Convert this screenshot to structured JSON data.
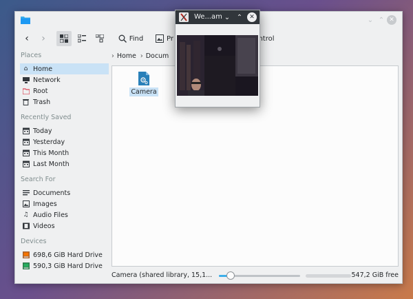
{
  "toolbar": {
    "find_label": "Find",
    "preview_label": "Pr",
    "control_label": "ntrol"
  },
  "sidebar": {
    "places_title": "Places",
    "places": [
      {
        "label": "Home",
        "icon": "home-icon"
      },
      {
        "label": "Network",
        "icon": "network-icon"
      },
      {
        "label": "Root",
        "icon": "folder-red-icon"
      },
      {
        "label": "Trash",
        "icon": "trash-icon"
      }
    ],
    "recent_title": "Recently Saved",
    "recent": [
      {
        "label": "Today",
        "icon": "calendar-icon"
      },
      {
        "label": "Yesterday",
        "icon": "calendar-icon"
      },
      {
        "label": "This Month",
        "icon": "calendar-icon"
      },
      {
        "label": "Last Month",
        "icon": "calendar-icon"
      }
    ],
    "search_title": "Search For",
    "search": [
      {
        "label": "Documents",
        "icon": "document-icon"
      },
      {
        "label": "Images",
        "icon": "image-icon"
      },
      {
        "label": "Audio Files",
        "icon": "music-icon"
      },
      {
        "label": "Videos",
        "icon": "video-icon"
      }
    ],
    "devices_title": "Devices",
    "devices": [
      {
        "label": "698,6 GiB Hard Drive",
        "icon": "harddrive-icon"
      },
      {
        "label": "590,3 GiB Hard Drive",
        "icon": "harddrive-icon"
      }
    ]
  },
  "breadcrumb": {
    "items": [
      "Home",
      "Docum"
    ]
  },
  "view": {
    "files": [
      {
        "name": "Camera",
        "icon": "library-icon"
      }
    ]
  },
  "status": {
    "text": "Camera (shared library, 15,1...",
    "free_space": "547,2 GiB free",
    "zoom_fraction": 0.1
  },
  "popup": {
    "title": "We...am"
  },
  "colors": {
    "selection": "#c9e2f6",
    "accent": "#3daee9",
    "popup_titlebar": "#31363b"
  }
}
